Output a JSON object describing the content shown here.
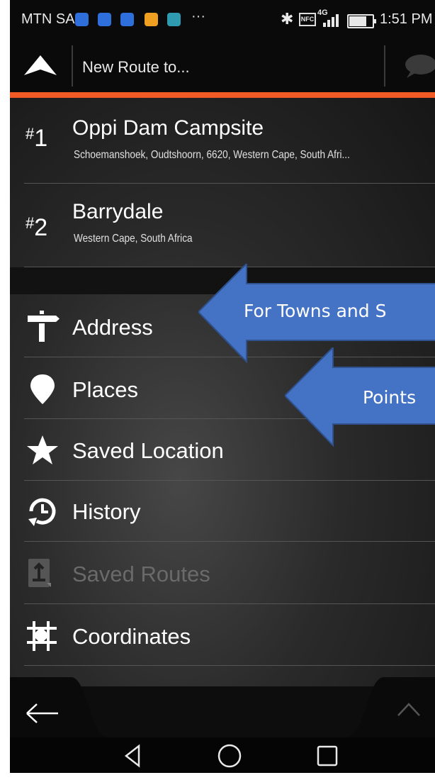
{
  "status_bar": {
    "carrier": "MTN SA",
    "more": "···",
    "network": "4G",
    "nfc": "NFC",
    "time": "1:51 PM",
    "battery_level": 0.8,
    "notification_colors": [
      "#2f6fdb",
      "#2f6fdb",
      "#2f6fdb",
      "#f0a020",
      "#2f9bb0"
    ]
  },
  "header": {
    "search_text": "New Route to...",
    "accent_color": "#f15a24"
  },
  "recent_destinations": [
    {
      "number": "#",
      "rank": "1",
      "title": "Oppi Dam Campsite",
      "subtitle": "Schoemanshoek, Oudtshoorn, 6620, Western Cape, South Afri..."
    },
    {
      "number": "#",
      "rank": "2",
      "title": "Barrydale",
      "subtitle": "Western Cape, South Africa"
    }
  ],
  "menu": [
    {
      "label": "Address",
      "icon": "signpost-icon",
      "enabled": true
    },
    {
      "label": "Places",
      "icon": "map-pin-icon",
      "enabled": true
    },
    {
      "label": "Saved Location",
      "icon": "star-icon",
      "enabled": true
    },
    {
      "label": "History",
      "icon": "history-clock-icon",
      "enabled": true
    },
    {
      "label": "Saved Routes",
      "icon": "saved-routes-icon",
      "enabled": false
    },
    {
      "label": "Coordinates",
      "icon": "coordinates-grid-icon",
      "enabled": true
    }
  ],
  "annotations": [
    {
      "text": "For Towns and S",
      "color": "#4472c4"
    },
    {
      "text": "Points",
      "color": "#4472c4"
    }
  ],
  "toolbar": {
    "back_icon": "back-arrow-icon",
    "up_icon": "chevron-up-icon"
  },
  "android_nav": [
    "back-triangle-icon",
    "home-circle-icon",
    "recents-square-icon"
  ]
}
